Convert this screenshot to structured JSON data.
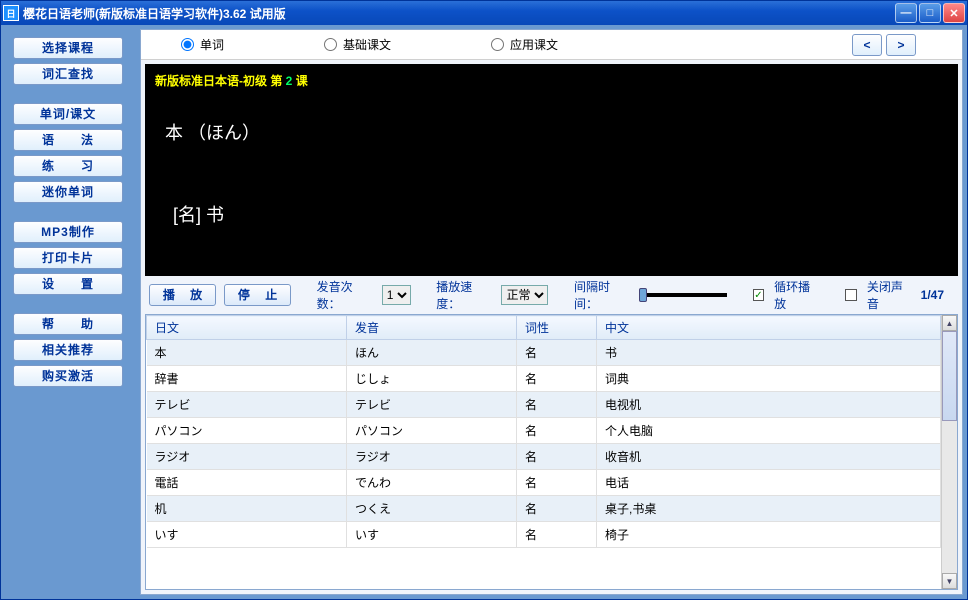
{
  "title": "樱花日语老师(新版标准日语学习软件)3.62 试用版",
  "sidebar": {
    "groups": [
      [
        "选择课程",
        "词汇查找"
      ],
      [
        "单词/课文",
        "语　　法",
        "练　　习",
        "迷你单词"
      ],
      [
        "MP3制作",
        "打印卡片",
        "设　　置"
      ],
      [
        "帮　　助",
        "相关推荐",
        "购买激活"
      ]
    ]
  },
  "radios": {
    "r1": "单词",
    "r2": "基础课文",
    "r3": "应用课文"
  },
  "lesson": {
    "title_prefix": "新版标准日本语-初级 第 ",
    "title_num": "2",
    "title_suffix": " 课",
    "kanji": "本 （ほん）",
    "meaning": "[名] 书"
  },
  "controls": {
    "play": "播 放",
    "stop": "停 止",
    "countLabel": "发音次数：",
    "count": "1",
    "speedLabel": "播放速度：",
    "speed": "正常",
    "intervalLabel": "间隔时间：",
    "loopLabel": "循环播放",
    "muteLabel": "关闭声音",
    "counter": "1/47"
  },
  "table": {
    "headers": {
      "jp": "日文",
      "py": "发音",
      "pos": "词性",
      "cn": "中文"
    },
    "rows": [
      {
        "jp": "本",
        "py": "ほん",
        "pos": "名",
        "cn": "书"
      },
      {
        "jp": "辞書",
        "py": "じしょ",
        "pos": "名",
        "cn": "词典"
      },
      {
        "jp": "テレビ",
        "py": "テレビ",
        "pos": "名",
        "cn": "电视机"
      },
      {
        "jp": "パソコン",
        "py": "パソコン",
        "pos": "名",
        "cn": "个人电脑"
      },
      {
        "jp": "ラジオ",
        "py": "ラジオ",
        "pos": "名",
        "cn": "收音机"
      },
      {
        "jp": "電話",
        "py": "でんわ",
        "pos": "名",
        "cn": "电话"
      },
      {
        "jp": "机",
        "py": "つくえ",
        "pos": "名",
        "cn": "桌子,书桌"
      },
      {
        "jp": "いす",
        "py": "いす",
        "pos": "名",
        "cn": "椅子"
      }
    ]
  }
}
